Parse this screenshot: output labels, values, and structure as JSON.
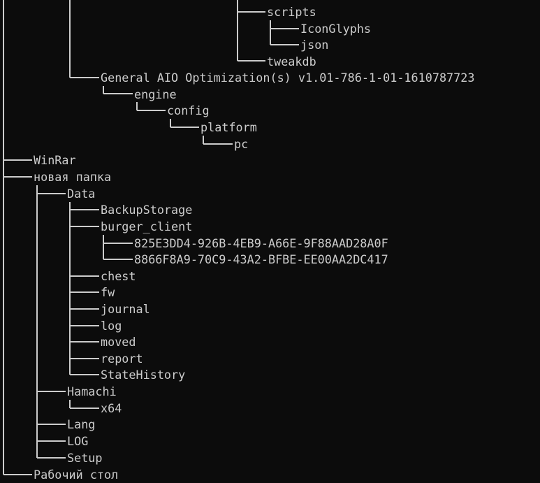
{
  "tree": {
    "top_block": {
      "scripts": "scripts",
      "iconglyphs": "IconGlyphs",
      "json": "json",
      "tweakdb": "tweakdb",
      "general_aio": "General AIO Optimization(s) v1.01-786-1-01-1610787723",
      "engine": "engine",
      "config": "config",
      "platform": "platform",
      "pc": "pc"
    },
    "winrar": "WinRar",
    "new_folder": {
      "label": "новая папка",
      "data": {
        "label": "Data",
        "backupstorage": "BackupStorage",
        "burger_client": {
          "label": "burger_client",
          "guid_1": "825E3DD4-926B-4EB9-A66E-9F88AAD28A0F",
          "guid_2": "8866F8A9-70C9-43A2-BFBE-EE00AA2DC417"
        },
        "chest": "chest",
        "fw": "fw",
        "journal": "journal",
        "log": "log",
        "moved": "moved",
        "report": "report",
        "statehistory": "StateHistory"
      },
      "hamachi": {
        "label": "Hamachi",
        "x64": "x64"
      },
      "lang": "Lang",
      "log_upper": "LOG",
      "setup": "Setup"
    },
    "desktop": "Рабочий стол"
  }
}
